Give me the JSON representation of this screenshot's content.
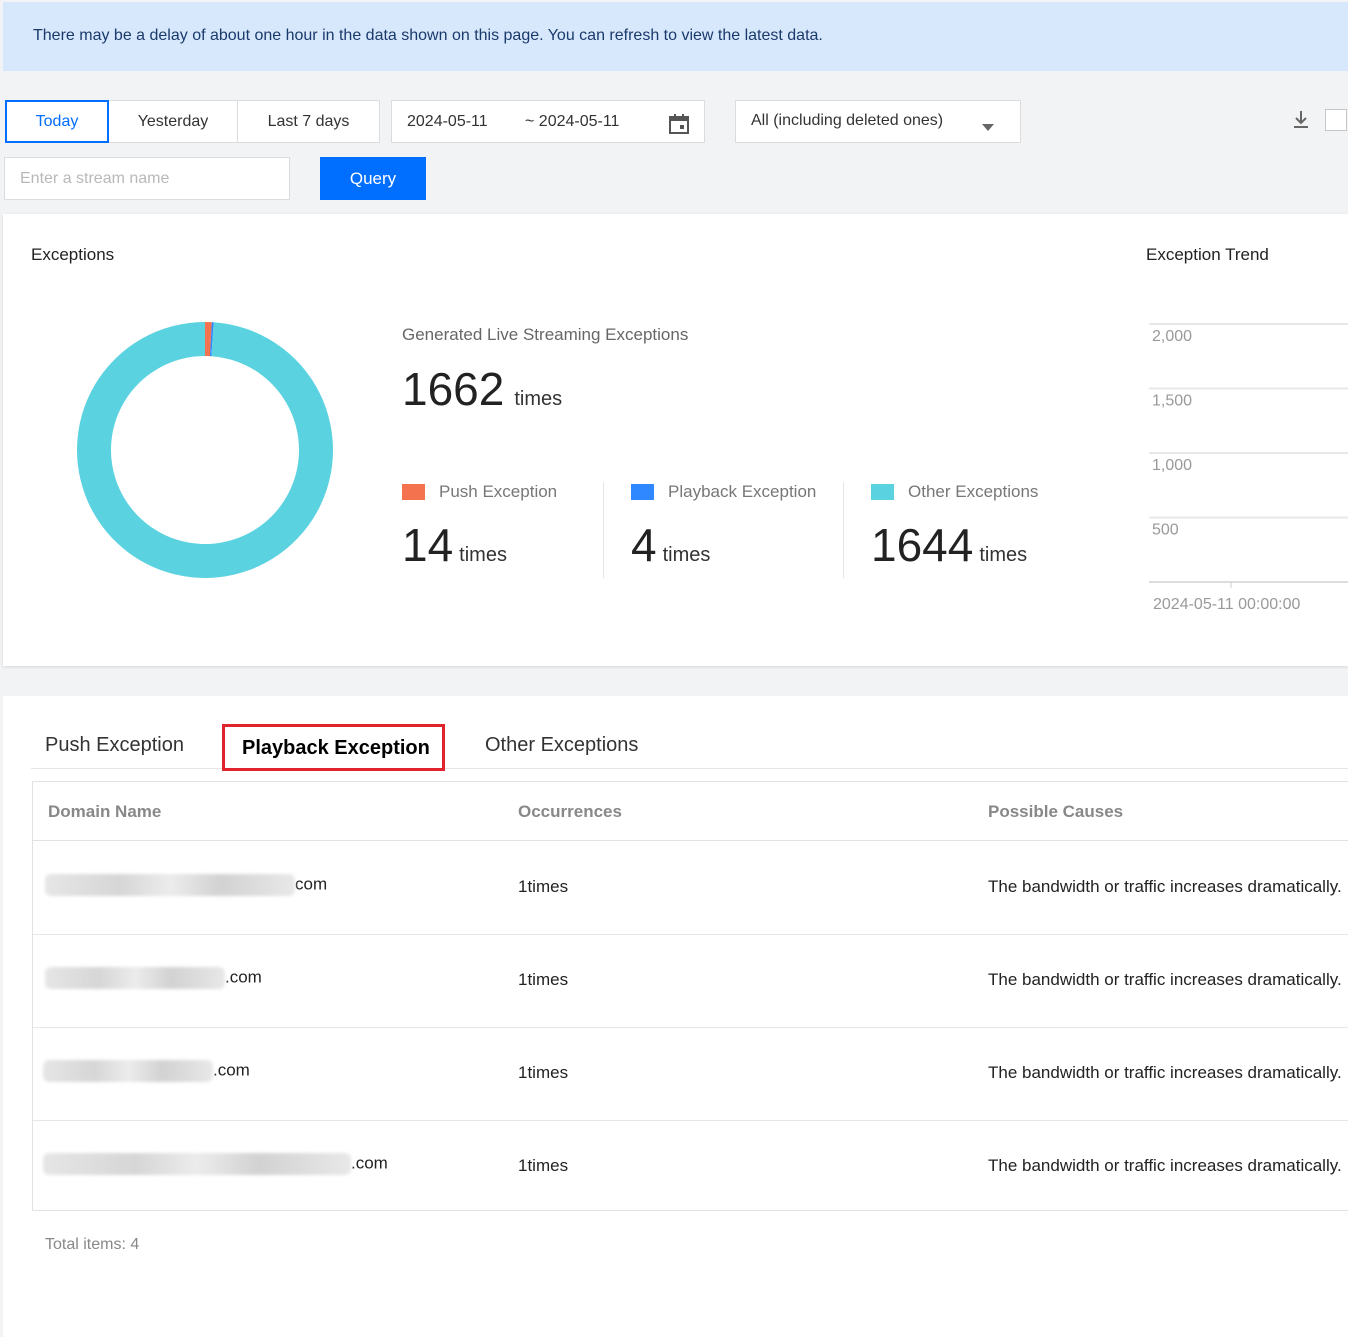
{
  "notice": "There may be a delay of about one hour in the data shown on this page. You can refresh to view the latest data.",
  "filters": {
    "ranges": [
      "Today",
      "Yesterday",
      "Last 7 days"
    ],
    "active_range": "Today",
    "start_date": "2024-05-11",
    "end_date": "~ 2024-05-11",
    "domain_select": "All (including deleted ones)",
    "stream_placeholder": "Enter a stream name",
    "query_label": "Query"
  },
  "exceptions_card": {
    "title": "Exceptions",
    "generated_label": "Generated Live Streaming Exceptions",
    "total": "1662",
    "unit": "times",
    "stats": [
      {
        "label": "Push Exception",
        "value": "14",
        "unit": "times",
        "color": "#f5724f"
      },
      {
        "label": "Playback Exception",
        "value": "4",
        "unit": "times",
        "color": "#2f88ff"
      },
      {
        "label": "Other Exceptions",
        "value": "1644",
        "unit": "times",
        "color": "#5ad2e0"
      }
    ]
  },
  "chart_data": [
    {
      "type": "pie",
      "categories": [
        "Push Exception",
        "Playback Exception",
        "Other Exceptions"
      ],
      "values": [
        14,
        4,
        1644
      ],
      "colors": [
        "#f5724f",
        "#2f88ff",
        "#5ad2e0"
      ],
      "title": "",
      "donut": true
    },
    {
      "type": "line",
      "title": "Exception Trend",
      "yticks": [
        "2,000",
        "1,500",
        "1,000",
        "500"
      ],
      "ylim": [
        0,
        2000
      ],
      "xticks": [
        "2024-05-11 00:00:00"
      ],
      "grid": true,
      "series": []
    }
  ],
  "tabs": [
    "Push Exception",
    "Playback Exception",
    "Other Exceptions"
  ],
  "active_tab": "Playback Exception",
  "table": {
    "columns": [
      "Domain Name",
      "Occurrences",
      "Possible Causes"
    ],
    "rows": [
      {
        "domain_suffix": "com",
        "occurrences": "1times",
        "cause": "The bandwidth or traffic increases dramatically."
      },
      {
        "domain_suffix": ".com",
        "occurrences": "1times",
        "cause": "The bandwidth or traffic increases dramatically."
      },
      {
        "domain_suffix": ".com",
        "occurrences": "1times",
        "cause": "The bandwidth or traffic increases dramatically."
      },
      {
        "domain_suffix": ".com",
        "occurrences": "1times",
        "cause": "The bandwidth or traffic increases dramatically."
      }
    ],
    "total_label": "Total items:  4"
  }
}
